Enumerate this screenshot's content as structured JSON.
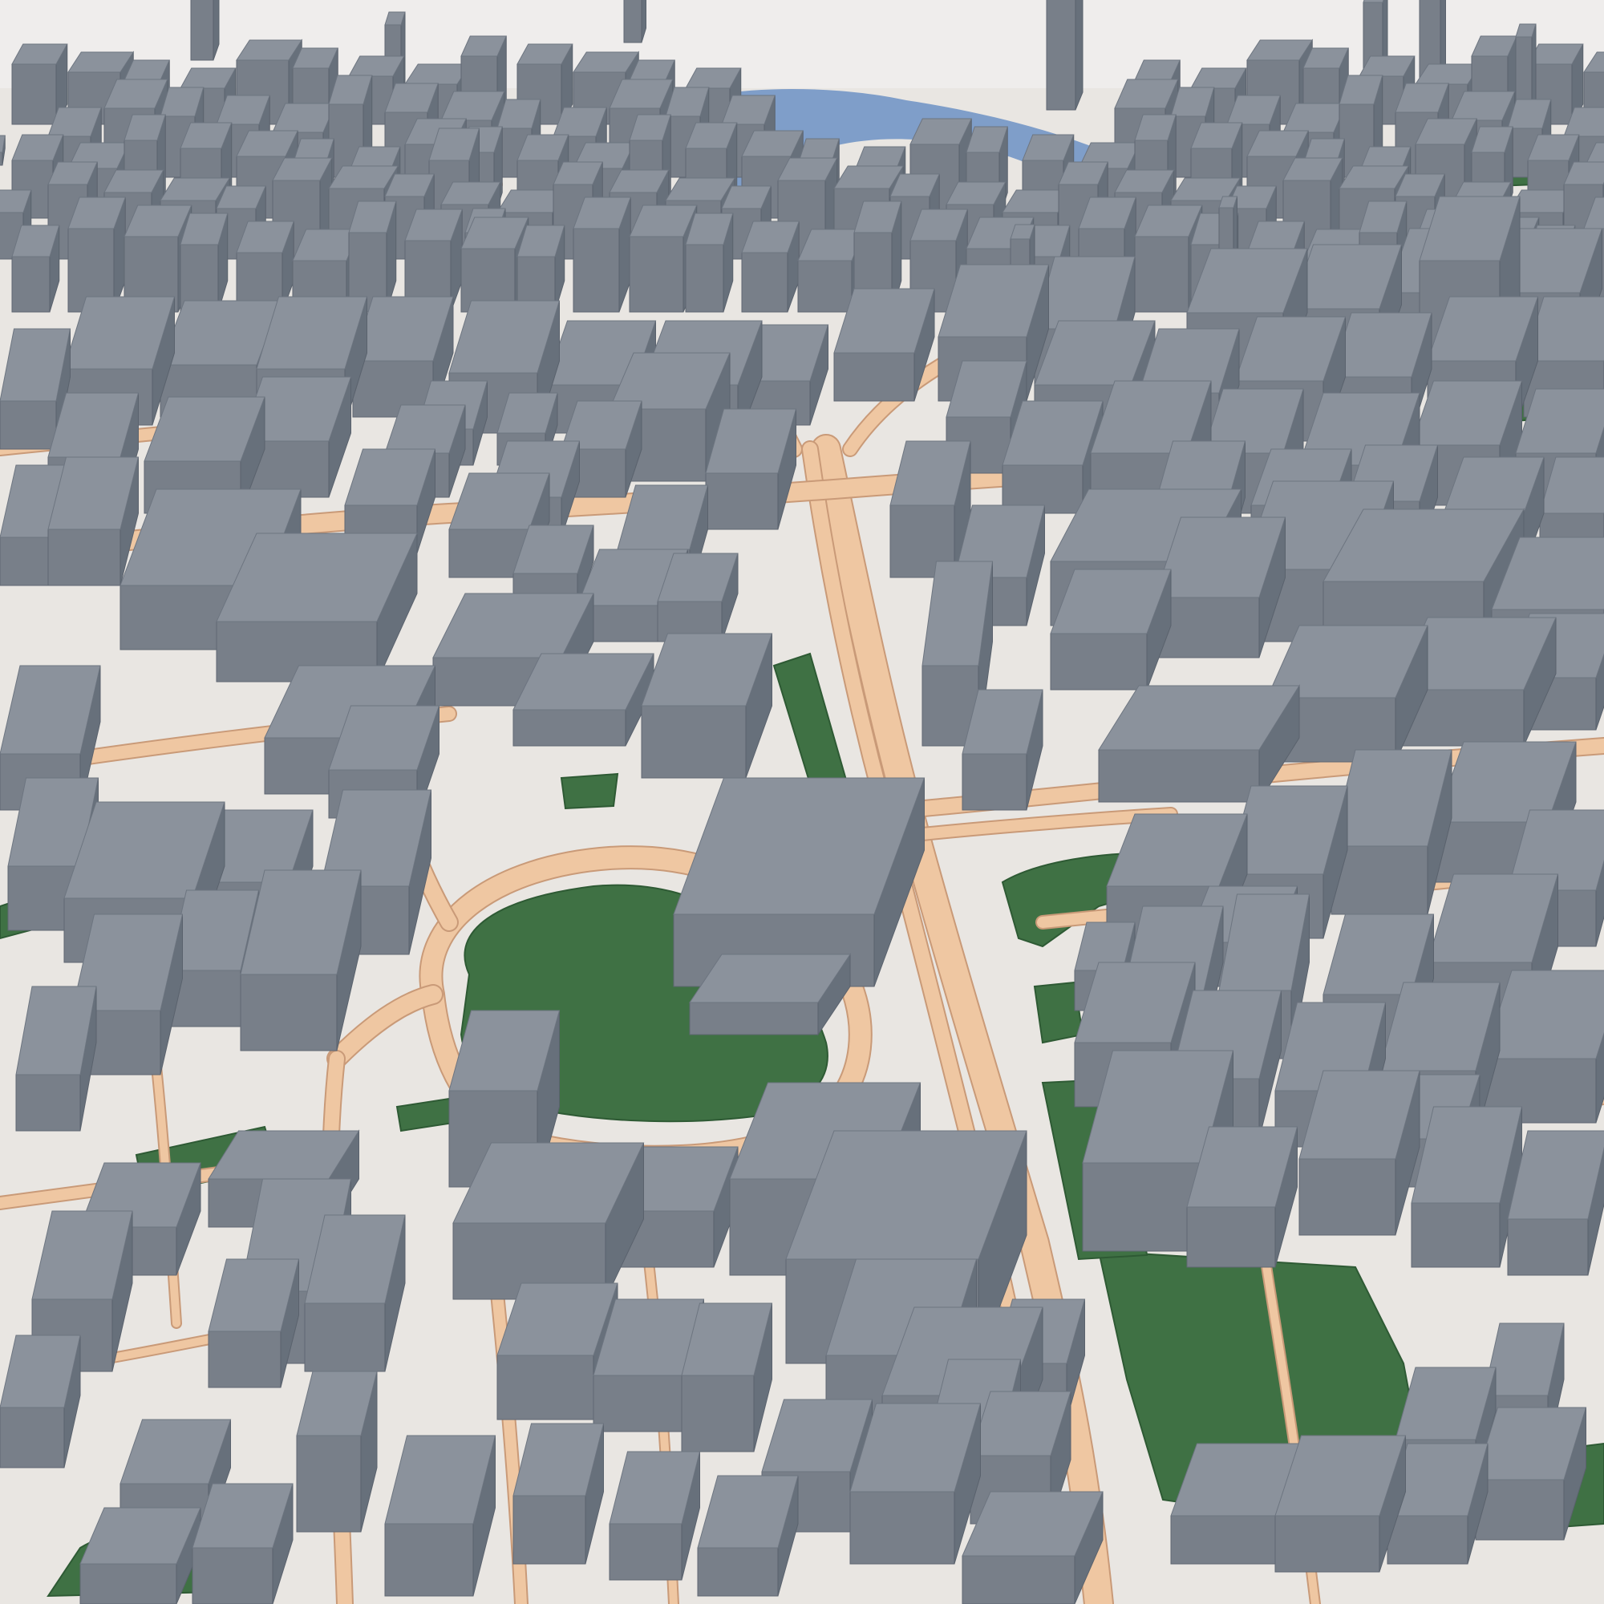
{
  "scene": {
    "kind": "3d-city-model-aerial-view",
    "labels": [],
    "colors": {
      "sky": "#efedec",
      "ground": "#e9e6e2",
      "road": "#efc7a2",
      "road_edge": "#c99a78",
      "park": "#3f7144",
      "park_edge": "#2e5a34",
      "river": "#7f9ec9",
      "building_top": "#8b929c",
      "building_left": "#787f89",
      "building_right": "#67707b"
    }
  }
}
